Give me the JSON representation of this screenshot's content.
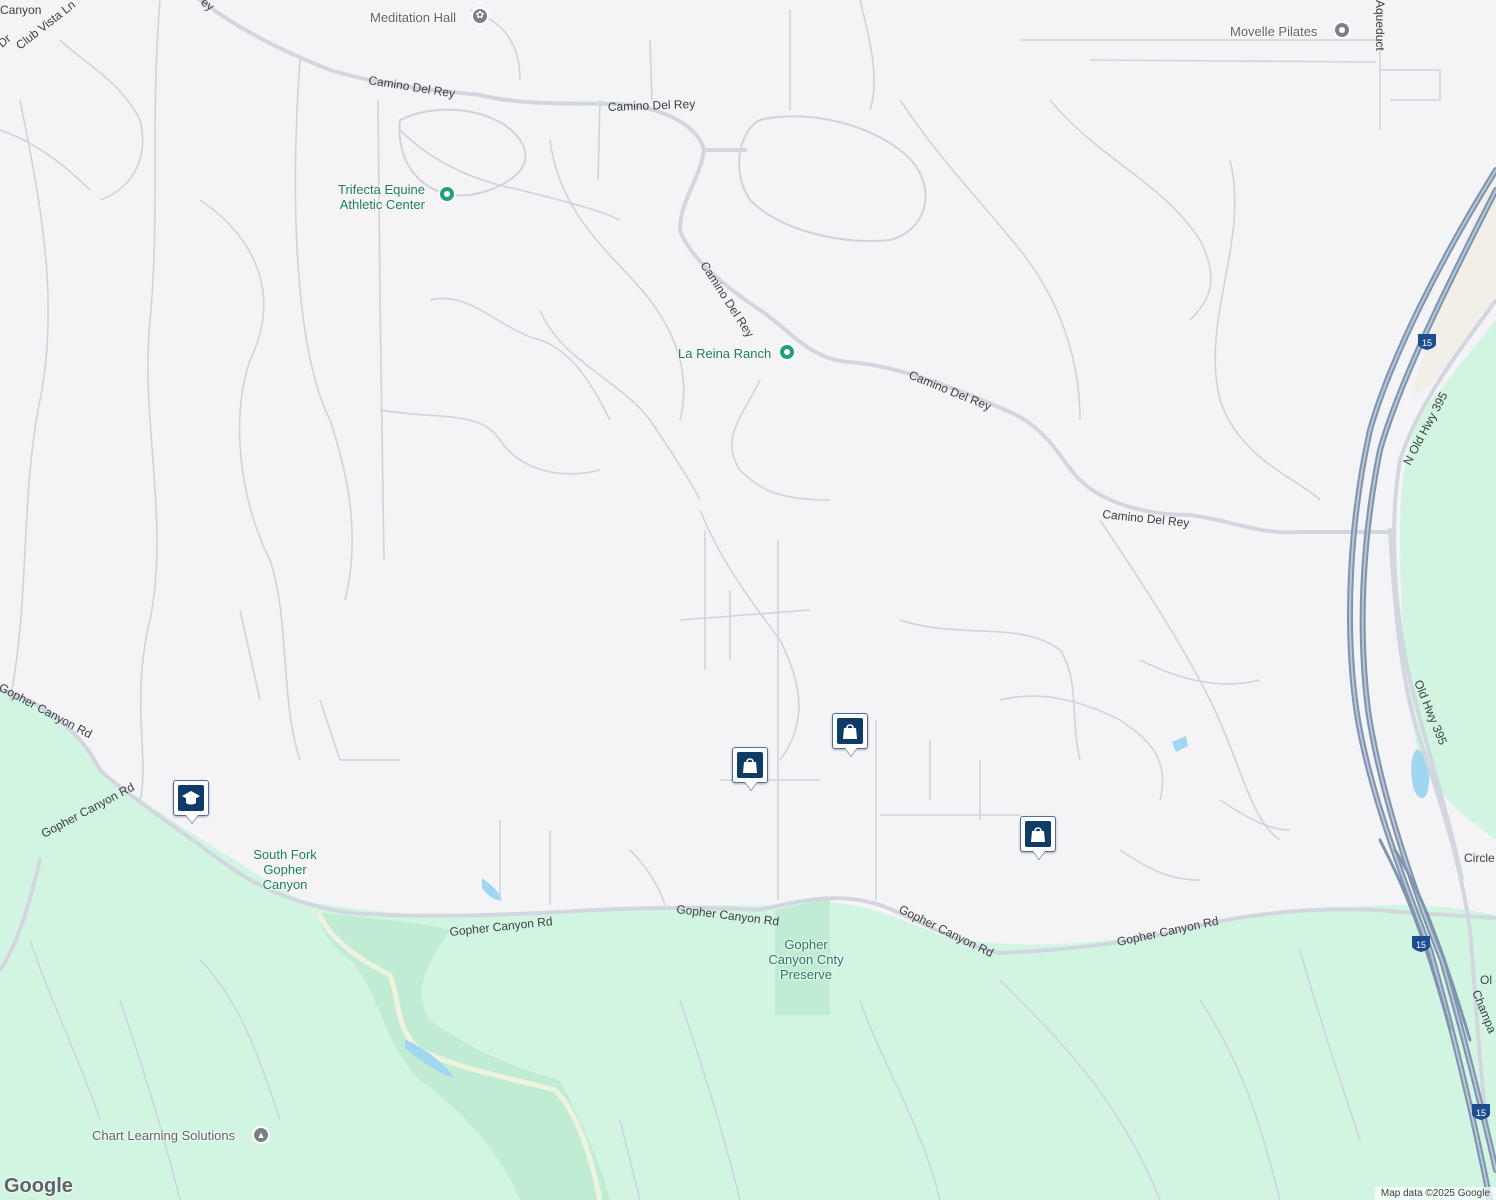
{
  "colors": {
    "background": "#f4f3f5",
    "park": "#d2f5e2",
    "road": "#cfd4dc",
    "major_road": "#d7dce3",
    "highway": "#7f94ae",
    "water": "#9fd6f0",
    "poi_green": "#22a07a",
    "marker": "#0f3b66"
  },
  "roads": {
    "camino_del_rey_1": "Camino Del Rey",
    "camino_del_rey_2": "Camino Del Rey",
    "camino_del_rey_3": "Camino Del Rey",
    "camino_del_rey_4": "Camino Del Rey",
    "camino_del_rey_5": "Camino Del Rey",
    "gopher_canyon_1": "Gopher Canyon Rd",
    "gopher_canyon_2": "Gopher Canyon Rd",
    "gopher_canyon_3": "Gopher Canyon Rd",
    "gopher_canyon_4": "Gopher Canyon Rd",
    "gopher_canyon_5": "Gopher Canyon Rd",
    "gopher_canyon_6": "Gopher Canyon Rd",
    "n_old_hwy_395": "N Old Hwy 395",
    "old_hwy_395": "Old Hwy 395",
    "club_vista": "Club Vista Ln",
    "circle": "Circle",
    "champ": "Champa",
    "old": "Ol",
    "canyon_top": "Canyon",
    "dr_top": "Dr",
    "ey_top": "ey",
    "aqueduct": "Aqueduct"
  },
  "highway_shields": [
    "15",
    "15",
    "15"
  ],
  "pois": {
    "meditation_hall": "Meditation Hall",
    "movelle_pilates": "Movelle Pilates",
    "trifecta_line1": "Trifecta Equine",
    "trifecta_line2": "Athletic Center",
    "la_reina_ranch": "La Reina Ranch",
    "south_fork_line1": "South Fork",
    "south_fork_line2": "Gopher",
    "south_fork_line3": "Canyon",
    "preserve_line1": "Gopher",
    "preserve_line2": "Canyon Cnty",
    "preserve_line3": "Preserve",
    "chart_learning": "Chart Learning Solutions"
  },
  "markers": [
    "shopping-bag-icon",
    "shopping-bag-icon",
    "shopping-bag-icon",
    "graduation-cap-icon"
  ],
  "footer": {
    "logo": "Google",
    "attribution": "Map data ©2025 Google"
  }
}
